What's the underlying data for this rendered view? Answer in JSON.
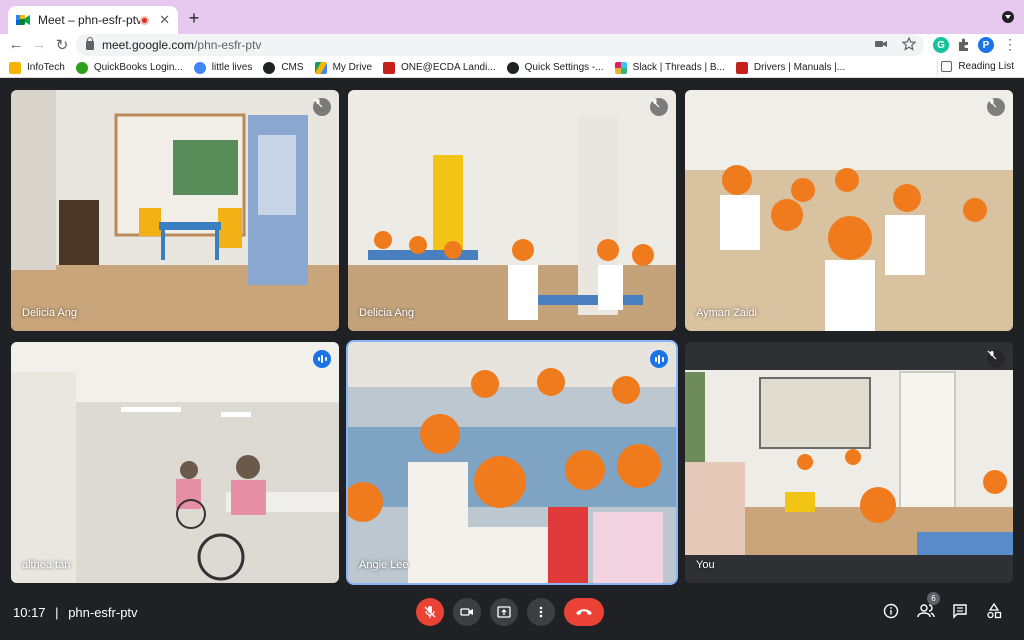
{
  "browser": {
    "tab_title": "Meet – phn-esfr-ptv",
    "new_tab": "+",
    "close_tab": "✕",
    "url_host": "meet.google.com",
    "url_path": "/phn-esfr-ptv",
    "profile_initial": "P",
    "bookmarks": [
      {
        "label": "InfoTech",
        "color": "#f4b400"
      },
      {
        "label": "QuickBooks Login...",
        "color": "#2ca01c"
      },
      {
        "label": "little lives",
        "color": "#4285f4"
      },
      {
        "label": "CMS",
        "color": "#202124"
      },
      {
        "label": "My Drive",
        "color": "#0f9d58"
      },
      {
        "label": "ONE@ECDA Landi...",
        "color": "#c5221f"
      },
      {
        "label": "Quick Settings -...",
        "color": "#202124"
      },
      {
        "label": "Slack | Threads | B...",
        "color": "#e01e5a"
      },
      {
        "label": "Drivers | Manuals |...",
        "color": "#c5221f"
      }
    ],
    "reading_list": "Reading List"
  },
  "meet": {
    "participants": [
      {
        "name": "Delicia Ang",
        "status": "muted"
      },
      {
        "name": "Delicia Ang",
        "status": "muted"
      },
      {
        "name": "Ayman Zaidi",
        "status": "muted"
      },
      {
        "name": "althea tan",
        "status": "speaking"
      },
      {
        "name": "Angie Lee",
        "status": "speaking"
      },
      {
        "name": "You",
        "status": "muted"
      }
    ],
    "time": "10:17",
    "divider": "|",
    "meeting_code": "phn-esfr-ptv",
    "participant_count": "6"
  },
  "colors": {
    "accent_blue": "#1a73e8",
    "end_call_red": "#ea4335",
    "hat_orange": "#f07b1d"
  }
}
